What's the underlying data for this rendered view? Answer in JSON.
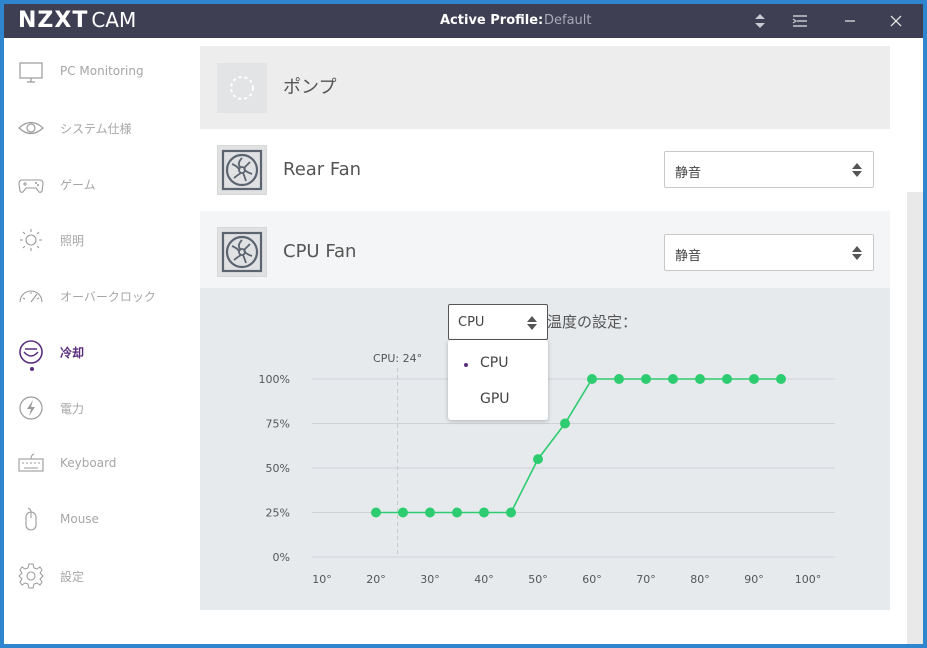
{
  "titlebar": {
    "logo_main": "NZXT",
    "logo_sub": "CAM",
    "profile_label": "Active Profile:",
    "profile_value": "Default"
  },
  "sidebar": {
    "items": [
      {
        "label": "PC Monitoring",
        "icon": "monitor-icon"
      },
      {
        "label": "システム仕様",
        "icon": "eye-icon"
      },
      {
        "label": "ゲーム",
        "icon": "gamepad-icon"
      },
      {
        "label": "照明",
        "icon": "light-icon"
      },
      {
        "label": "オーバークロック",
        "icon": "gauge-icon"
      },
      {
        "label": "冷却",
        "icon": "cooling-icon"
      },
      {
        "label": "電力",
        "icon": "power-icon"
      },
      {
        "label": "Keyboard",
        "icon": "keyboard-icon"
      },
      {
        "label": "Mouse",
        "icon": "mouse-icon"
      },
      {
        "label": "設定",
        "icon": "gear-icon"
      }
    ],
    "active_index": 5
  },
  "devices": {
    "pump": {
      "title": "ポンプ"
    },
    "rear_fan": {
      "title": "Rear Fan",
      "mode": "静音"
    },
    "cpu_fan": {
      "title": "CPU Fan",
      "mode": "静音"
    }
  },
  "curve": {
    "source_value": "CPU",
    "temp_label": "温度の設定：",
    "options": [
      "CPU",
      "GPU"
    ],
    "selected_option": "CPU",
    "current_temp_label": "CPU: 24°",
    "current_temp": 24
  },
  "chart_data": {
    "type": "line",
    "x": [
      20,
      25,
      30,
      35,
      40,
      45,
      50,
      55,
      60,
      65,
      70,
      75,
      80,
      85,
      90,
      95
    ],
    "y": [
      25,
      25,
      25,
      25,
      25,
      25,
      55,
      75,
      100,
      100,
      100,
      100,
      100,
      100,
      100,
      100
    ],
    "x_ticks": [
      "10°",
      "20°",
      "30°",
      "40°",
      "50°",
      "60°",
      "70°",
      "80°",
      "90°",
      "100°"
    ],
    "y_ticks": [
      "100%",
      "75%",
      "50%",
      "25%",
      "0%"
    ],
    "xlim": [
      10,
      100
    ],
    "ylim": [
      0,
      100
    ],
    "grid": true,
    "line_color": "#2ecc71"
  }
}
